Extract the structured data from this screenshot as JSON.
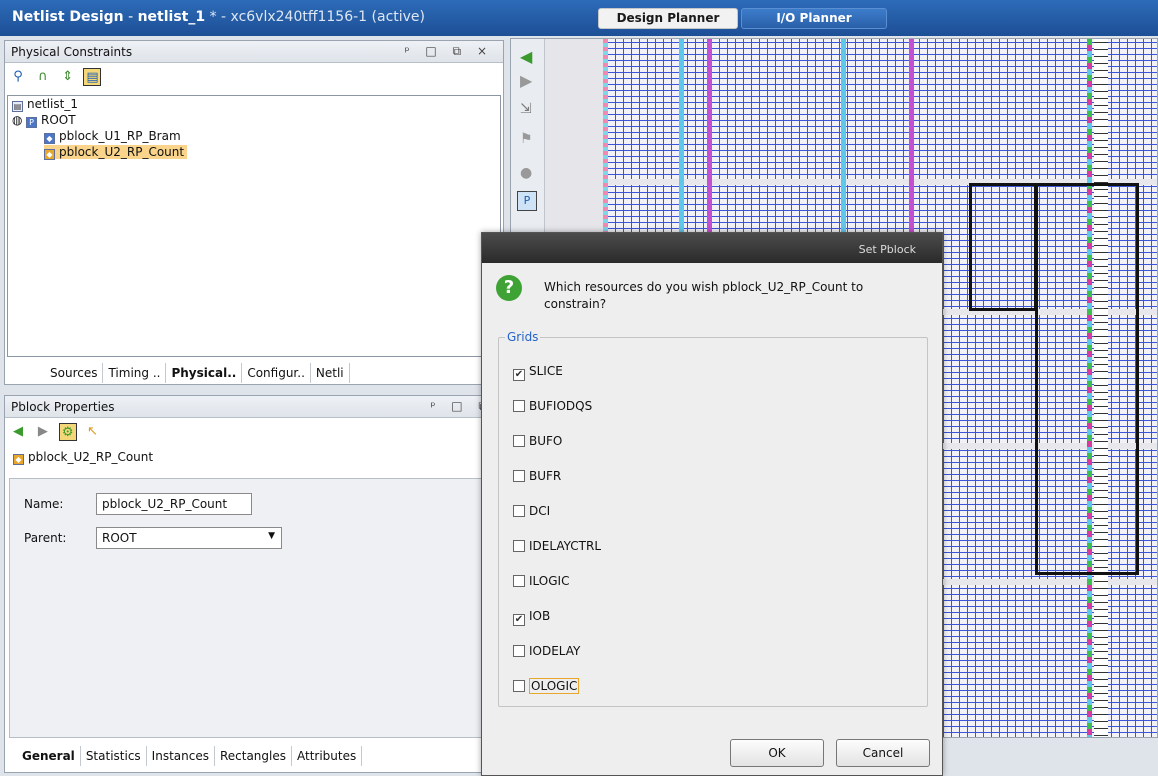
{
  "window": {
    "title_bold": "Netlist Design",
    "title_file": "netlist_1",
    "title_rest": "* - xc6vlx240tff1156-1 (active)",
    "tabs": [
      "Design Planner",
      "I/O Planner"
    ]
  },
  "physical_constraints": {
    "title": "Physical Constraints",
    "tree": {
      "root_label": "netlist_1",
      "node_label": "ROOT",
      "children": [
        "pblock_U1_RP_Bram",
        "pblock_U2_RP_Count"
      ]
    },
    "tabs": [
      "Sources",
      "Timing ..",
      "Physical..",
      "Configur..",
      "Netli"
    ]
  },
  "pblock_properties": {
    "title": "Pblock Properties",
    "selected": "pblock_U2_RP_Count",
    "name_label": "Name:",
    "name_value": "pblock_U2_RP_Count",
    "parent_label": "Parent:",
    "parent_value": "ROOT",
    "tabs": [
      "General",
      "Statistics",
      "Instances",
      "Rectangles",
      "Attributes"
    ]
  },
  "dialog": {
    "title": "Set Pblock",
    "message": "Which resources do you wish pblock_U2_RP_Count to constrain?",
    "group_label": "Grids",
    "options": [
      {
        "label": "SLICE",
        "checked": true
      },
      {
        "label": "BUFIODQS",
        "checked": false
      },
      {
        "label": "BUFO",
        "checked": false
      },
      {
        "label": "BUFR",
        "checked": false
      },
      {
        "label": "DCI",
        "checked": false
      },
      {
        "label": "IDELAYCTRL",
        "checked": false
      },
      {
        "label": "ILOGIC",
        "checked": false
      },
      {
        "label": "IOB",
        "checked": true
      },
      {
        "label": "IODELAY",
        "checked": false
      },
      {
        "label": "OLOGIC",
        "checked": false
      }
    ],
    "ok_label": "OK",
    "cancel_label": "Cancel"
  },
  "icons": {
    "check": "✔",
    "question": "?"
  },
  "colors": {
    "title_bar": "#1d4f96",
    "grid_line": "#3a55d6",
    "selection_highlight": "#f9d48a",
    "accent_question": "#3fa235"
  }
}
